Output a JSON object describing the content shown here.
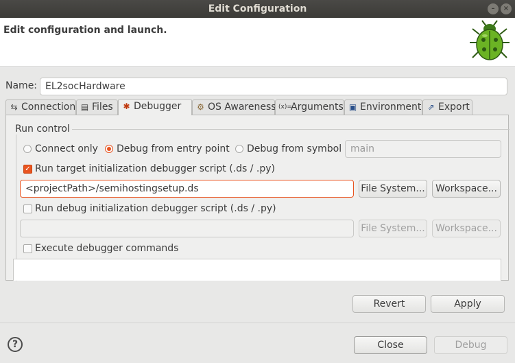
{
  "window": {
    "title": "Edit Configuration"
  },
  "header": {
    "title": "Edit configuration and launch."
  },
  "name": {
    "label": "Name:",
    "value": "EL2socHardware"
  },
  "tabs": [
    {
      "label": "Connection",
      "icon": "connection-icon",
      "active": false
    },
    {
      "label": "Files",
      "icon": "files-icon",
      "active": false
    },
    {
      "label": "Debugger",
      "icon": "debugger-icon",
      "active": true
    },
    {
      "label": "OS Awareness",
      "icon": "os-awareness-icon",
      "active": false
    },
    {
      "label": "Arguments",
      "icon": "arguments-icon",
      "active": false
    },
    {
      "label": "Environment",
      "icon": "environment-icon",
      "active": false
    },
    {
      "label": "Export",
      "icon": "export-icon",
      "active": false
    }
  ],
  "run_control": {
    "group_label": "Run control",
    "radio_connect_only": "Connect only",
    "radio_debug_entry": "Debug from entry point",
    "radio_debug_symbol": "Debug from symbol",
    "selected": "Debug from entry point",
    "symbol_value": "main",
    "target_init_label": "Run target initialization debugger script (.ds / .py)",
    "target_init_checked": true,
    "target_init_path": "<projectPath>/semihostingsetup.ds",
    "debug_init_label": "Run debug initialization debugger script (.ds / .py)",
    "debug_init_checked": false,
    "debug_init_path": "",
    "execute_commands_label": "Execute debugger commands",
    "execute_commands_checked": false
  },
  "buttons": {
    "file_system": "File System...",
    "workspace": "Workspace...",
    "revert": "Revert",
    "apply": "Apply",
    "close": "Close",
    "debug": "Debug",
    "help": "?"
  },
  "colors": {
    "accent": "#e95420",
    "titlebar": "#3c3b37",
    "background": "#efefee"
  }
}
